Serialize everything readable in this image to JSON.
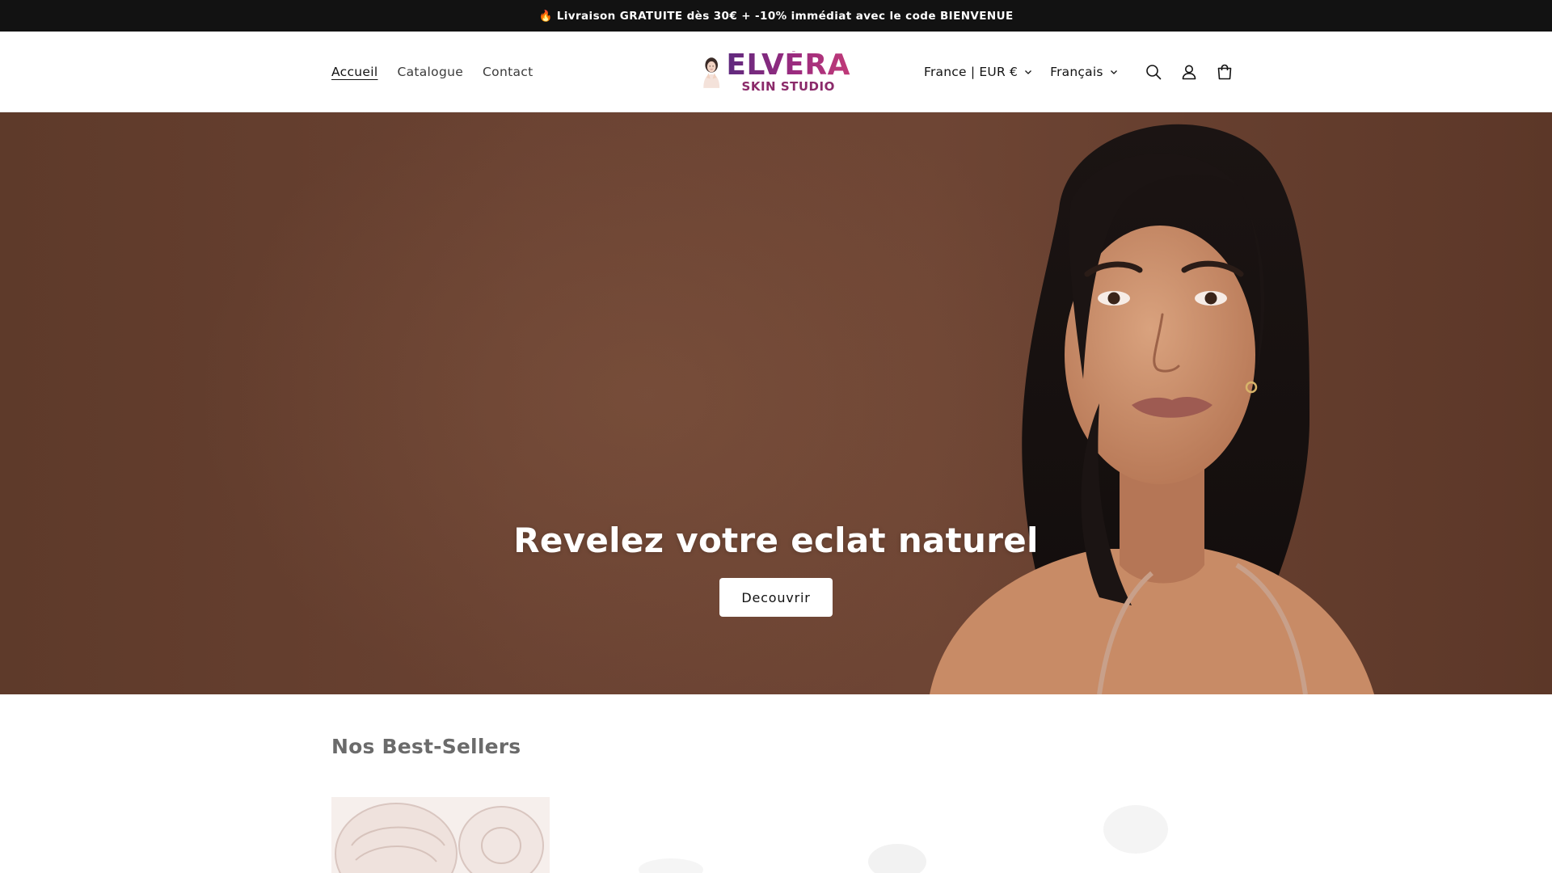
{
  "announcement": {
    "text": "🔥 Livraison GRATUITE dès 30€ + -10% immédiat avec le code BIENVENUE"
  },
  "header": {
    "nav": [
      {
        "label": "Accueil",
        "active": true
      },
      {
        "label": "Catalogue",
        "active": false
      },
      {
        "label": "Contact",
        "active": false
      }
    ],
    "logo": {
      "main": "ELVÉRA",
      "sub": "SKIN STUDIO"
    },
    "country_selector": "France | EUR €",
    "language_selector": "Français",
    "icons": [
      "search-icon",
      "account-icon",
      "cart-icon"
    ]
  },
  "hero": {
    "title": "Revelez votre eclat naturel",
    "button_label": "Decouvrir"
  },
  "bestsellers": {
    "title": "Nos Best-Sellers"
  },
  "colors": {
    "announcement_bg": "#121212",
    "hero_bg": "#6a4232",
    "logo_gradient_start": "#5e2a7e",
    "logo_gradient_end": "#c03a78"
  }
}
